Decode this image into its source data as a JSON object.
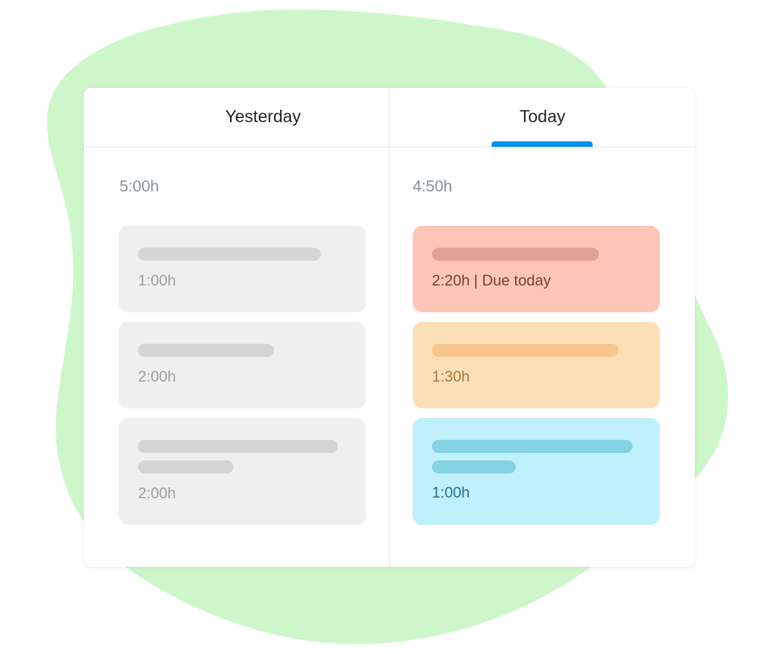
{
  "tabs": {
    "yesterday": "Yesterday",
    "today": "Today",
    "active": "today"
  },
  "yesterday": {
    "total": "5:00h",
    "tasks": [
      {
        "time": "1:00h"
      },
      {
        "time": "2:00h"
      },
      {
        "time": "2:00h"
      }
    ]
  },
  "today": {
    "total": "4:50h",
    "tasks": [
      {
        "time": "2:20h | Due today"
      },
      {
        "time": "1:30h"
      },
      {
        "time": "1:00h"
      }
    ]
  },
  "colors": {
    "background_blob": "#cdf7cb",
    "tab_indicator": "#0a8fee",
    "task_grey": "#efefef",
    "task_red": "#fdc6b6",
    "task_orange": "#fddfb7",
    "task_blue": "#c0f0fb"
  }
}
